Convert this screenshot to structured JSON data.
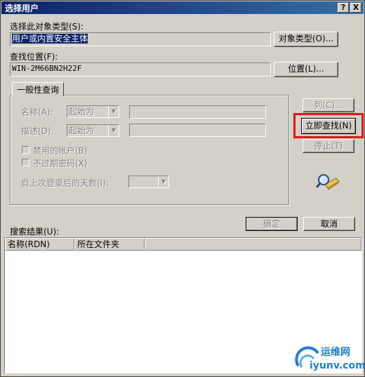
{
  "window": {
    "title": "选择用户",
    "help_button": "?",
    "close_button": "X"
  },
  "object_type": {
    "label": "选择此对象类型(S):",
    "value": "用户或内置安全主体",
    "button": "对象类型(O)..."
  },
  "location": {
    "label": "查找位置(F):",
    "value": "WIN-2M66BN2H22F",
    "button": "位置(L)..."
  },
  "common_query": {
    "tab": "一般性查询",
    "name_label": "名称(A):",
    "name_op": "起始为",
    "desc_label": "描述(D):",
    "desc_op": "起始为",
    "disabled_accounts": "禁用的帐户(B)",
    "non_expiring_pw": "不过期密码(X)",
    "days_label": "自上次登录后的天数(I):"
  },
  "side_buttons": {
    "columns": "列(C)...",
    "find_now": "立即查找(N)",
    "stop": "停止(T)"
  },
  "dialog_buttons": {
    "ok": "确定",
    "cancel": "取消"
  },
  "results": {
    "label": "搜索结果(U):",
    "columns": [
      "名称(RDN)",
      "所在文件夹"
    ]
  },
  "watermark": {
    "brand": "运维网",
    "url": "iyunv.com"
  },
  "colors": {
    "title_bar": "#0a246a",
    "highlight_box": "#e01515",
    "watermark_blue": "#1a7fd0"
  }
}
